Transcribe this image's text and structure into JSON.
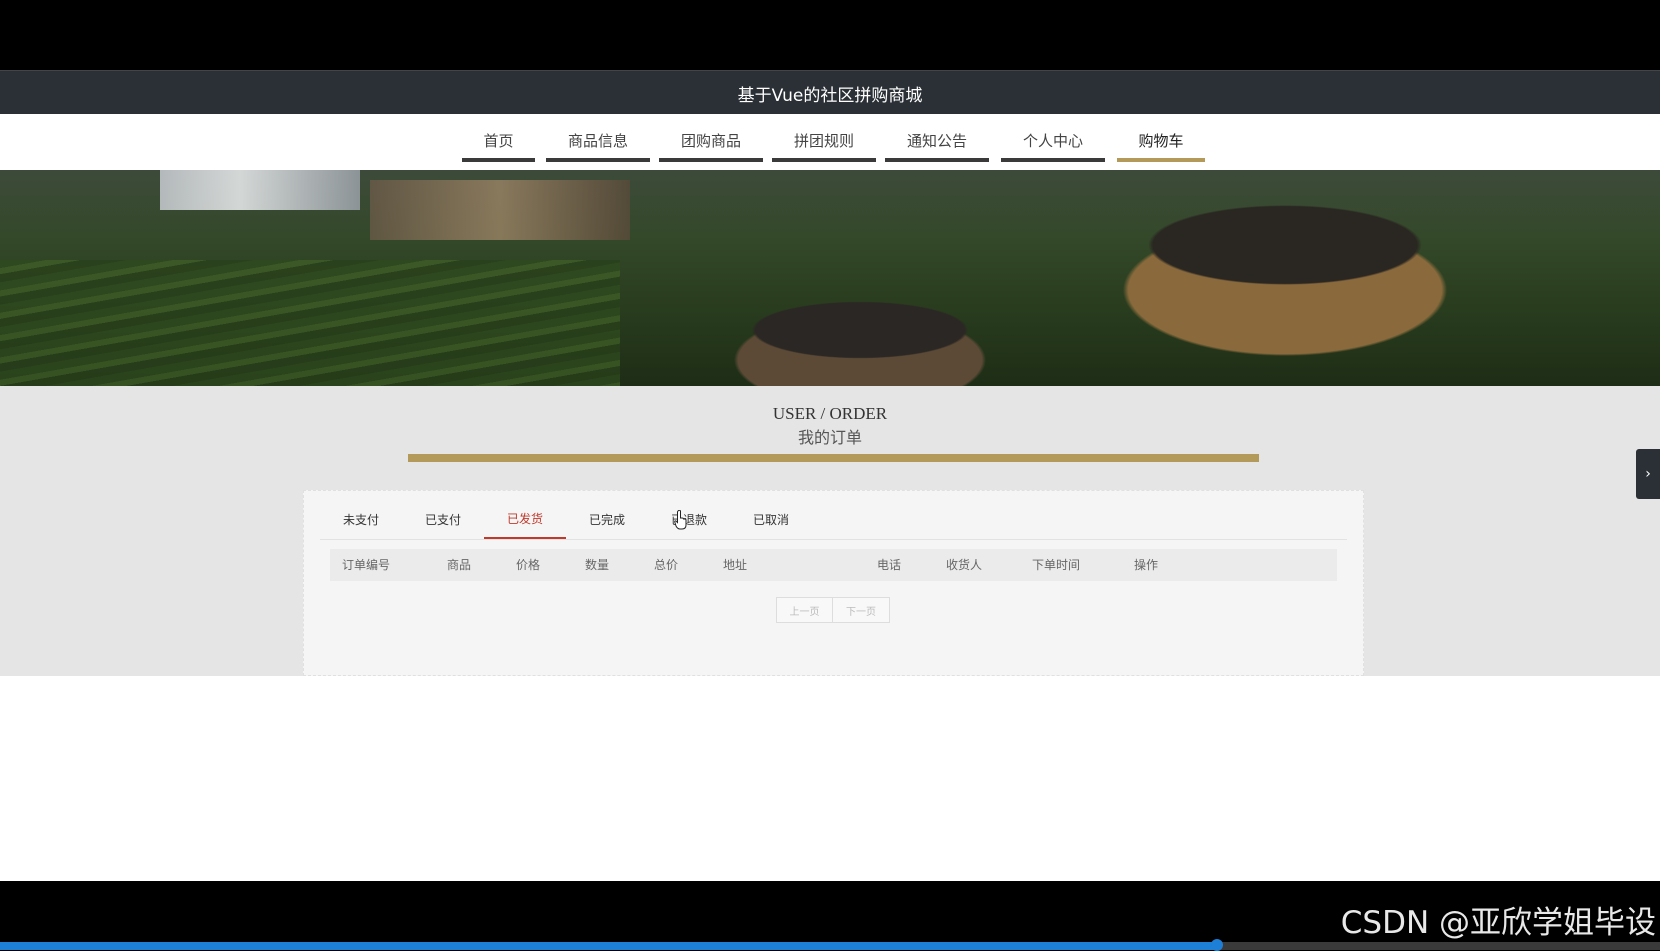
{
  "header": {
    "title": "基于Vue的社区拼购商城"
  },
  "nav": {
    "items": [
      {
        "label": "首页",
        "active": false
      },
      {
        "label": "商品信息",
        "active": false
      },
      {
        "label": "团购商品",
        "active": false
      },
      {
        "label": "拼团规则",
        "active": false
      },
      {
        "label": "通知公告",
        "active": false
      },
      {
        "label": "个人中心",
        "active": false
      },
      {
        "label": "购物车",
        "active": true
      }
    ]
  },
  "page_heading": {
    "en": "USER / ORDER",
    "cn": "我的订单"
  },
  "order_tabs": [
    {
      "label": "未支付",
      "active": false
    },
    {
      "label": "已支付",
      "active": false
    },
    {
      "label": "已发货",
      "active": true
    },
    {
      "label": "已完成",
      "active": false
    },
    {
      "label": "已退款",
      "active": false
    },
    {
      "label": "已取消",
      "active": false
    }
  ],
  "table": {
    "columns": [
      "订单编号",
      "商品",
      "价格",
      "数量",
      "总价",
      "地址",
      "电话",
      "收货人",
      "下单时间",
      "操作"
    ],
    "rows": []
  },
  "pager": {
    "prev": "上一页",
    "next": "下一页"
  },
  "side_toggle_icon": "chevron-right-icon",
  "watermark": "CSDN @亚欣学姐毕设",
  "video_progress": 0.733,
  "colors": {
    "accent": "#b49a5a",
    "active_tab": "#c0392b",
    "title_bar": "#2b3036"
  }
}
